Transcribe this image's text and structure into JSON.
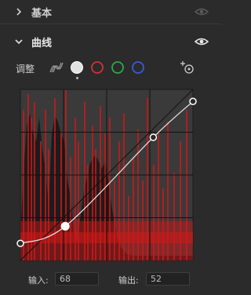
{
  "panels": {
    "basic": {
      "title": "基本",
      "collapsed": true,
      "visible_icon": "eye-icon"
    },
    "curves": {
      "title": "曲线",
      "collapsed": false,
      "visible_icon": "eye-icon"
    }
  },
  "adjust": {
    "label": "调整",
    "channels": [
      {
        "name": "luminance",
        "color": "#d0d0d0"
      },
      {
        "name": "red",
        "color": "#d23232"
      },
      {
        "name": "green",
        "color": "#2fa84a"
      },
      {
        "name": "blue",
        "color": "#3a5ad8"
      }
    ],
    "selected_channel": "luminance",
    "point_tool_icon": "target-plus-icon",
    "mode_icon": "curve-stripes-icon"
  },
  "curve_points": [
    {
      "input": 0,
      "output": 10
    },
    {
      "input": 26,
      "output": 20
    },
    {
      "input": 77,
      "output": 72
    },
    {
      "input": 100,
      "output": 93
    }
  ],
  "io": {
    "input_label": "输入:",
    "input_value": "68",
    "output_label": "输出:",
    "output_value": "52"
  },
  "colors": {
    "background": "#2b2b2b",
    "accent_red": "#d01818"
  }
}
